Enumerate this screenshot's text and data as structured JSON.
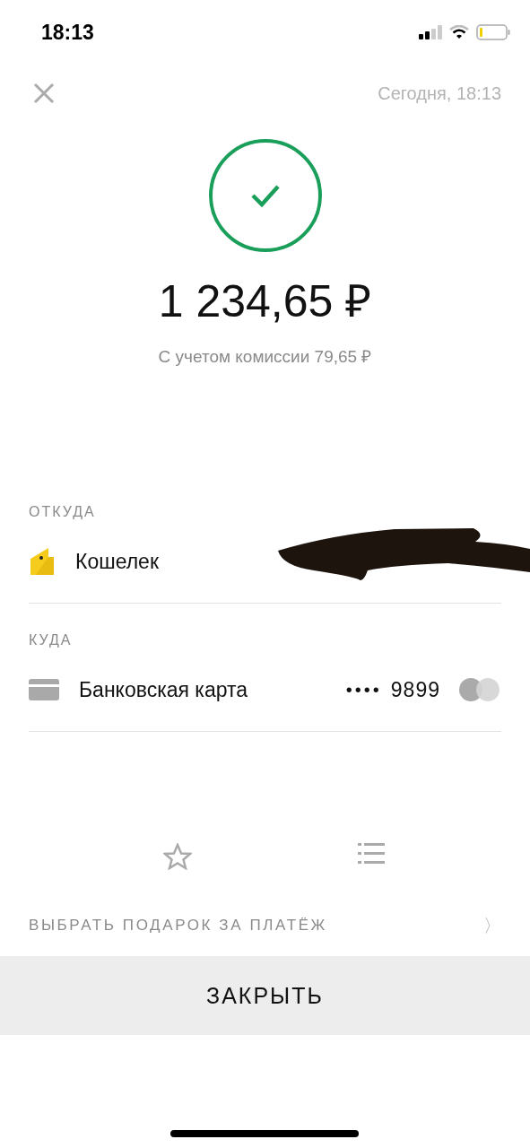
{
  "status_bar": {
    "time": "18:13"
  },
  "header": {
    "date": "Сегодня, 18:13"
  },
  "payment": {
    "amount": "1 234,65 ₽",
    "commission": "С учетом комиссии 79,65 ₽"
  },
  "sections": [
    {
      "label": "ОТКУДА",
      "kind": "wallet",
      "name": "Кошелек",
      "redacted": true
    },
    {
      "label": "КУДА",
      "kind": "card",
      "name": "Банковская карта",
      "mask": "••••",
      "number": "9899"
    }
  ],
  "gift_link": {
    "label": "ВЫБРАТЬ ПОДАРОК ЗА ПЛАТЁЖ",
    "chevron": "〉"
  },
  "close_button": {
    "label": "ЗАКРЫТЬ"
  }
}
